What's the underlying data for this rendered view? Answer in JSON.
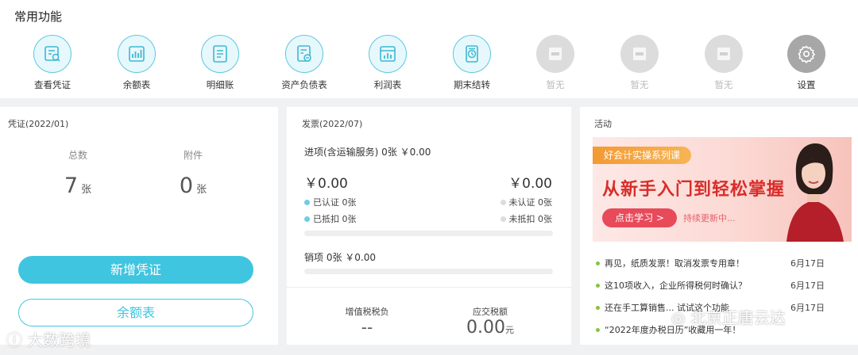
{
  "top": {
    "title": "常用功能",
    "functions": [
      {
        "label": "查看凭证",
        "icon": "voucher-search-icon"
      },
      {
        "label": "余额表",
        "icon": "bar-chart-icon"
      },
      {
        "label": "明细账",
        "icon": "ledger-icon"
      },
      {
        "label": "资产负债表",
        "icon": "balance-sheet-icon"
      },
      {
        "label": "利润表",
        "icon": "profit-chart-icon"
      },
      {
        "label": "期末结转",
        "icon": "period-close-icon"
      },
      {
        "label": "暂无",
        "icon": "placeholder-icon"
      },
      {
        "label": "暂无",
        "icon": "placeholder-icon"
      },
      {
        "label": "暂无",
        "icon": "placeholder-icon"
      },
      {
        "label": "设置",
        "icon": "gear-icon"
      }
    ]
  },
  "voucher": {
    "title": "凭证(2022/01)",
    "total_label": "总数",
    "total_value": "7",
    "attach_label": "附件",
    "attach_value": "0",
    "unit": "张",
    "add_button": "新增凭证",
    "balance_button": "余额表"
  },
  "invoice": {
    "title": "发票(2022/07)",
    "input_line": "进项(含运输服务)  0张  ￥0.00",
    "amount_left": "￥0.00",
    "amount_right": "￥0.00",
    "certified": "已认证   0张",
    "uncertified": "未认证   0张",
    "deducted": "已抵扣   0张",
    "undeducted": "未抵扣   0张",
    "output_line": "销项    0张    ￥0.00",
    "vat_label": "增值税税负",
    "vat_value": "--",
    "tax_label": "应交税额",
    "tax_value": "0.00",
    "tax_unit": "元"
  },
  "activity": {
    "title": "活动",
    "banner": {
      "tag": "好会计实操系列课",
      "headline": "从新手入门到轻松掌握",
      "button": "点击学习 >",
      "sub": "持续更新中..."
    },
    "news": [
      {
        "text": "再见，纸质发票！取消发票专用章！",
        "date": "6月17日"
      },
      {
        "text": "这10项收入，企业所得税何时确认？",
        "date": "6月17日"
      },
      {
        "text": "还在手工算销售... 试试这个功能",
        "date": "6月17日"
      },
      {
        "text": "“2022年度办税日历”收藏用一年！",
        "date": ""
      }
    ]
  },
  "watermark": {
    "left": "大数跨境",
    "right": "北京正唐云达"
  },
  "colors": {
    "accent": "#3fc5df",
    "news_dot": "#86c440",
    "banner_red": "#d82d2a"
  }
}
